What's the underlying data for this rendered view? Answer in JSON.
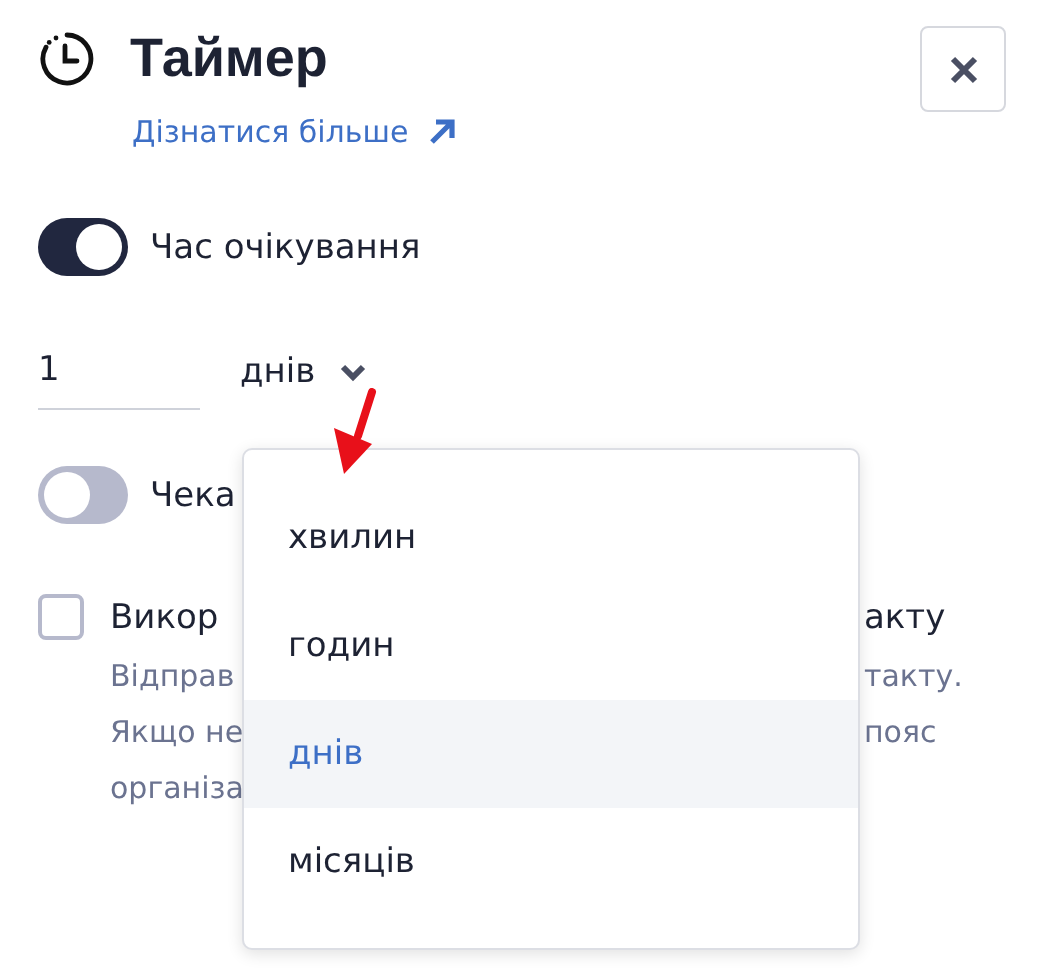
{
  "header": {
    "title": "Таймер",
    "link": "Дізнатися більше"
  },
  "wait_toggle": {
    "label": "Час очікування",
    "on": true
  },
  "duration": {
    "value": "1",
    "unit": "днів"
  },
  "second_toggle": {
    "label": "Чека",
    "on": false
  },
  "checkbox": {
    "checked": false,
    "label_start": "Викор",
    "label_end": "акту"
  },
  "description": {
    "lines": [
      {
        "start": "Відправ",
        "end": "такту."
      },
      {
        "start": "Якщо не",
        "end": "пояс"
      },
      {
        "start": "організа"
      }
    ]
  },
  "dropdown": {
    "options": [
      {
        "label": "хвилин",
        "selected": false
      },
      {
        "label": "годин",
        "selected": false
      },
      {
        "label": "днів",
        "selected": true
      },
      {
        "label": "місяців",
        "selected": false
      }
    ]
  }
}
